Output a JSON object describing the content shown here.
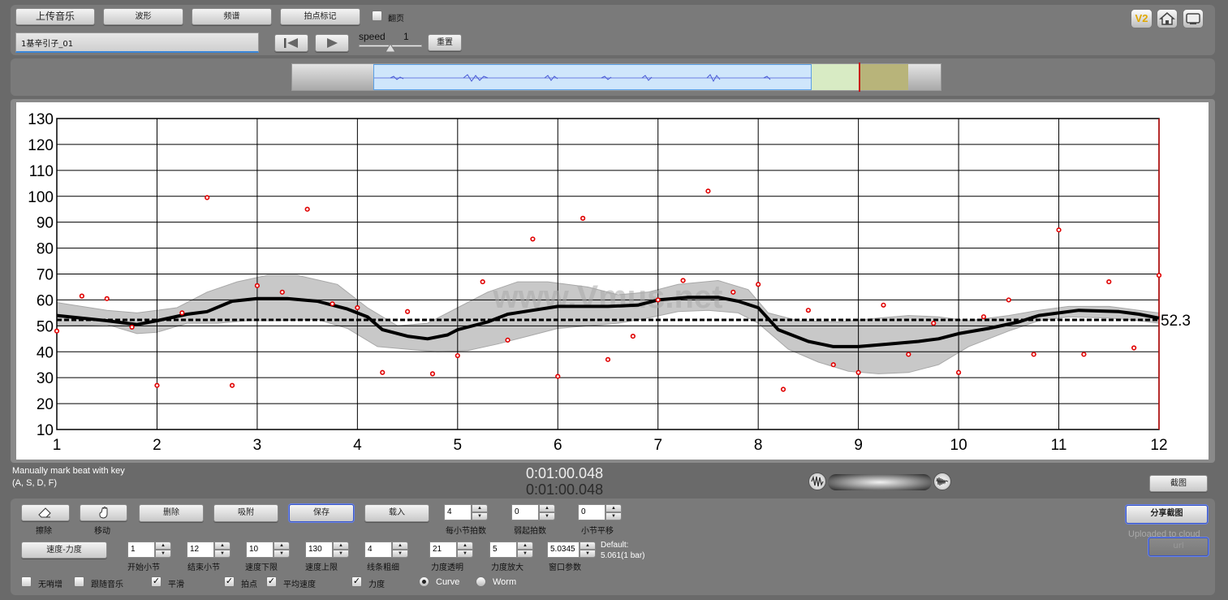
{
  "toolbar": {
    "upload_label": "上传音乐",
    "waveform_label": "波形",
    "spectrum_label": "频谱",
    "beat_mark_label": "拍点标记",
    "flip_label": "翻页",
    "file_name": "1基辛引子_01",
    "speed_label": "speed",
    "speed_value": "1",
    "speed_fraction": 0.5,
    "reset_label": "重置",
    "v2_label": "V2"
  },
  "chart_data": {
    "type": "scatter",
    "x_ticks": [
      "1",
      "2",
      "3",
      "4",
      "5",
      "6",
      "7",
      "8",
      "9",
      "10",
      "11",
      "12"
    ],
    "y_ticks": [
      "130",
      "120",
      "110",
      "100",
      "90",
      "80",
      "70",
      "60",
      "50",
      "40",
      "30",
      "20",
      "10"
    ],
    "xlim": [
      1,
      12
    ],
    "ylim": [
      10,
      130
    ],
    "grid": true,
    "average_value": 52.3,
    "average_label": "52.3",
    "watermark": "www.Vmus.net",
    "series": [
      {
        "name": "beats",
        "points": [
          [
            1,
            48
          ],
          [
            1.25,
            61.5
          ],
          [
            1.5,
            60.5
          ],
          [
            1.75,
            49.5
          ],
          [
            2,
            27
          ],
          [
            2.25,
            55
          ],
          [
            2.5,
            99.5
          ],
          [
            2.75,
            27
          ],
          [
            3,
            65.5
          ],
          [
            3.25,
            63
          ],
          [
            3.5,
            95
          ],
          [
            3.75,
            58.5
          ],
          [
            4,
            57
          ],
          [
            4.25,
            32
          ],
          [
            4.5,
            55.5
          ],
          [
            4.75,
            31.5
          ],
          [
            5,
            38.5
          ],
          [
            5.25,
            67
          ],
          [
            5.5,
            44.5
          ],
          [
            5.75,
            83.5
          ],
          [
            6,
            30.5
          ],
          [
            6.25,
            91.5
          ],
          [
            6.5,
            37
          ],
          [
            6.75,
            46
          ],
          [
            7,
            60
          ],
          [
            7.25,
            67.5
          ],
          [
            7.5,
            102
          ],
          [
            7.75,
            63
          ],
          [
            8,
            66
          ],
          [
            8.25,
            25.5
          ],
          [
            8.5,
            56
          ],
          [
            8.75,
            35
          ],
          [
            9,
            32
          ],
          [
            9.25,
            58
          ],
          [
            9.5,
            39
          ],
          [
            9.75,
            51
          ],
          [
            10,
            32
          ],
          [
            10.25,
            53.5
          ],
          [
            10.5,
            60
          ],
          [
            10.75,
            39
          ],
          [
            11,
            87
          ],
          [
            11.25,
            39
          ],
          [
            11.5,
            67
          ],
          [
            11.75,
            41.5
          ],
          [
            12,
            69.5
          ]
        ]
      },
      {
        "name": "smooth",
        "points": [
          [
            1,
            54
          ],
          [
            1.5,
            52
          ],
          [
            1.8,
            50.5
          ],
          [
            2,
            52
          ],
          [
            2.3,
            54.5
          ],
          [
            2.5,
            55.5
          ],
          [
            2.75,
            59.5
          ],
          [
            3,
            60.5
          ],
          [
            3.3,
            60.5
          ],
          [
            3.6,
            59.5
          ],
          [
            3.9,
            56.5
          ],
          [
            4.1,
            53.5
          ],
          [
            4.25,
            48.5
          ],
          [
            4.5,
            46
          ],
          [
            4.7,
            45
          ],
          [
            4.9,
            46.5
          ],
          [
            5,
            48.5
          ],
          [
            5.3,
            51.5
          ],
          [
            5.5,
            54.5
          ],
          [
            5.75,
            56
          ],
          [
            6,
            57.5
          ],
          [
            6.5,
            57.5
          ],
          [
            6.8,
            58
          ],
          [
            7,
            60
          ],
          [
            7.3,
            61
          ],
          [
            7.6,
            61
          ],
          [
            7.8,
            59.5
          ],
          [
            8,
            57
          ],
          [
            8.2,
            48.5
          ],
          [
            8.5,
            44
          ],
          [
            8.75,
            42
          ],
          [
            9,
            42
          ],
          [
            9.3,
            43
          ],
          [
            9.6,
            44
          ],
          [
            9.8,
            45
          ],
          [
            10,
            47
          ],
          [
            10.3,
            49
          ],
          [
            10.6,
            51.5
          ],
          [
            10.8,
            54
          ],
          [
            11,
            55
          ],
          [
            11.2,
            56
          ],
          [
            11.6,
            55.5
          ],
          [
            11.8,
            54.5
          ],
          [
            12,
            53
          ]
        ]
      },
      {
        "name": "band_upper",
        "points": [
          [
            1,
            59
          ],
          [
            1.5,
            56
          ],
          [
            1.8,
            55
          ],
          [
            2.2,
            57
          ],
          [
            2.5,
            63
          ],
          [
            2.8,
            67
          ],
          [
            3.1,
            69.5
          ],
          [
            3.4,
            69.5
          ],
          [
            3.8,
            66
          ],
          [
            4.1,
            57
          ],
          [
            4.4,
            50
          ],
          [
            4.7,
            51
          ],
          [
            5,
            57
          ],
          [
            5.3,
            63
          ],
          [
            5.6,
            67
          ],
          [
            5.9,
            67
          ],
          [
            6.3,
            65
          ],
          [
            6.6,
            62
          ],
          [
            6.9,
            63
          ],
          [
            7.2,
            66
          ],
          [
            7.6,
            67.5
          ],
          [
            7.9,
            64
          ],
          [
            8.1,
            55
          ],
          [
            8.4,
            52
          ],
          [
            8.8,
            51.5
          ],
          [
            9.2,
            53
          ],
          [
            9.5,
            54
          ],
          [
            9.8,
            53.5
          ],
          [
            10.1,
            52
          ],
          [
            10.5,
            54
          ],
          [
            10.8,
            56
          ],
          [
            11.1,
            57.5
          ],
          [
            11.5,
            57.5
          ],
          [
            11.8,
            56
          ],
          [
            12,
            55
          ]
        ]
      },
      {
        "name": "band_lower",
        "points": [
          [
            1,
            50
          ],
          [
            1.5,
            50.5
          ],
          [
            1.8,
            47
          ],
          [
            2,
            47.5
          ],
          [
            2.3,
            51
          ],
          [
            2.6,
            51
          ],
          [
            2.9,
            52
          ],
          [
            3.2,
            52
          ],
          [
            3.6,
            52.5
          ],
          [
            3.9,
            49
          ],
          [
            4.2,
            42
          ],
          [
            4.5,
            41
          ],
          [
            4.8,
            40
          ],
          [
            5.1,
            40.5
          ],
          [
            5.4,
            43
          ],
          [
            5.7,
            46
          ],
          [
            6,
            49
          ],
          [
            6.3,
            50
          ],
          [
            6.6,
            51
          ],
          [
            6.9,
            53
          ],
          [
            7.2,
            55.5
          ],
          [
            7.5,
            56
          ],
          [
            7.8,
            55
          ],
          [
            8,
            51
          ],
          [
            8.3,
            41
          ],
          [
            8.6,
            36
          ],
          [
            8.9,
            32.5
          ],
          [
            9.2,
            31.5
          ],
          [
            9.5,
            32
          ],
          [
            9.8,
            35
          ],
          [
            10.1,
            42
          ],
          [
            10.5,
            48
          ],
          [
            10.8,
            52
          ],
          [
            11.1,
            53.5
          ],
          [
            11.5,
            53
          ],
          [
            11.8,
            52
          ],
          [
            12,
            51
          ]
        ]
      }
    ]
  },
  "status": {
    "hint_line1": "Manually mark beat with key",
    "hint_line2": "(A, S, D, F)",
    "time1": "0:01:00.048",
    "time2": "0:01:00.048",
    "screenshot_label": "截图"
  },
  "controls": {
    "erase_label": "擦除",
    "move_label": "移动",
    "delete_label": "删除",
    "snap_label": "吸附",
    "save_label": "保存",
    "load_label": "载入",
    "tempo_dynamic_label": "速度-力度",
    "beats_per_bar": {
      "value": "4",
      "label": "每小节拍数"
    },
    "pickup_beats": {
      "value": "0",
      "label": "弱起拍数"
    },
    "bar_shift": {
      "value": "0",
      "label": "小节平移"
    },
    "start_bar": {
      "value": "1",
      "label": "开始小节"
    },
    "end_bar": {
      "value": "12",
      "label": "结束小节"
    },
    "tempo_min": {
      "value": "10",
      "label": "速度下限"
    },
    "tempo_max": {
      "value": "130",
      "label": "速度上限"
    },
    "line_width": {
      "value": "4",
      "label": "线条粗细"
    },
    "dynamic_opacity": {
      "value": "21",
      "label": "力度透明"
    },
    "dynamic_zoom": {
      "value": "5",
      "label": "力度放大"
    },
    "window_param": {
      "value": "5.0345",
      "label": "窗口参数"
    },
    "default_line1": "Default:",
    "default_line2": "5.061(1 bar)",
    "share_label": "分享截图",
    "uploaded_label": "Uploaded to cloud",
    "url_label": "url",
    "checks": [
      {
        "label": "无哨增",
        "checked": false
      },
      {
        "label": "跟随音乐",
        "checked": false
      },
      {
        "label": "平滑",
        "checked": true
      },
      {
        "label": "拍点",
        "checked": true
      },
      {
        "label": "平均速度",
        "checked": true
      },
      {
        "label": "力度",
        "checked": true
      }
    ],
    "radio_curve": "Curve",
    "radio_worm": "Worm"
  }
}
